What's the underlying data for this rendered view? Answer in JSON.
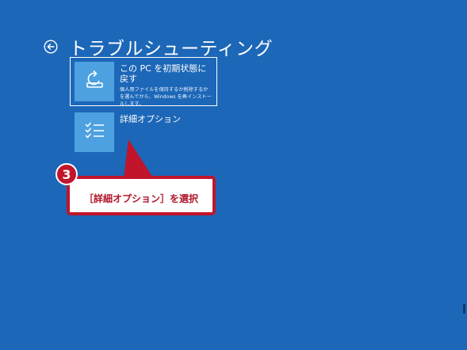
{
  "header": {
    "title": "トラブルシューティング",
    "back_icon": "back-arrow-circle-icon"
  },
  "options": [
    {
      "title": "この PC を初期状態に戻す",
      "description": "個人用ファイルを保持するか削除するかを選んでから、Windows を再インストールします。",
      "icon": "reset-pc-icon"
    },
    {
      "title": "詳細オプション",
      "icon": "checklist-icon"
    }
  ],
  "annotation": {
    "step_number": "3",
    "text": "［詳細オプション］を選択"
  },
  "colors": {
    "background": "#1c67b8",
    "tile": "#4ea1e0",
    "callout_red": "#c0152a",
    "text": "#ffffff"
  }
}
